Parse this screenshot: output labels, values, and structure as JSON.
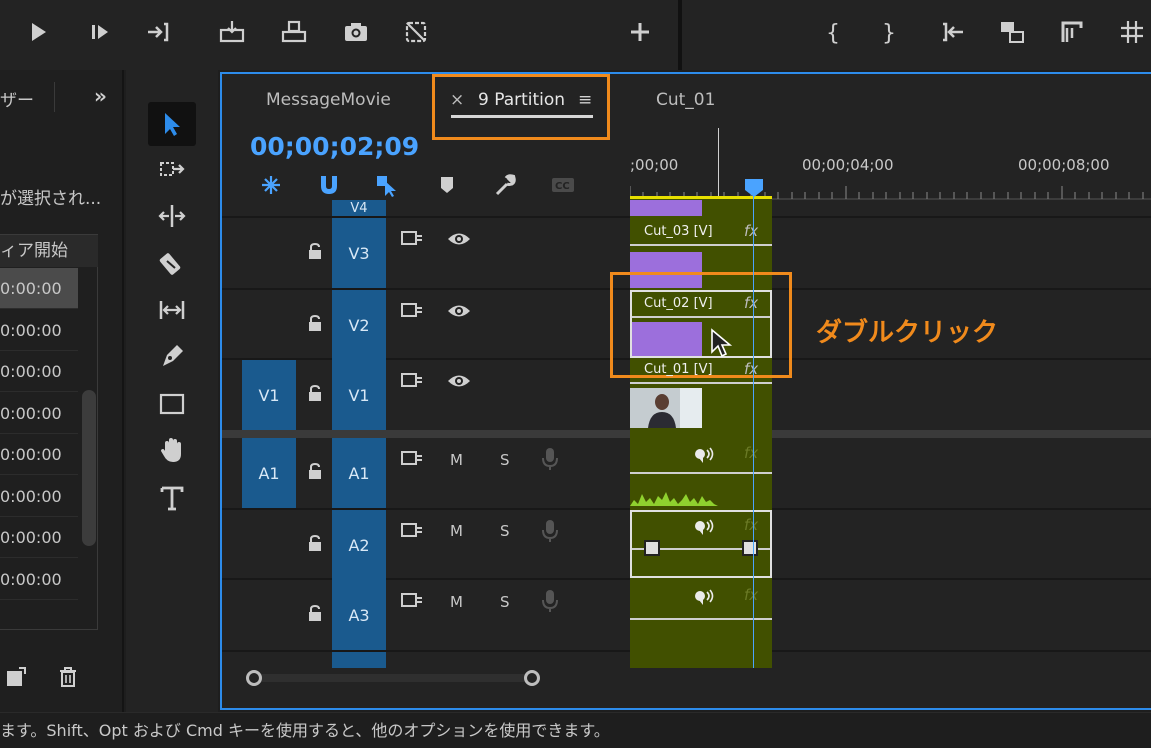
{
  "toolbar": {
    "left_buttons": [
      "play-icon",
      "step-forward-icon",
      "go-to-out-icon",
      "insert-icon",
      "overwrite-icon",
      "export-frame-icon",
      "button-editor-icon",
      "add-button-icon"
    ],
    "right_buttons": [
      "mark-in-icon",
      "mark-out-icon",
      "go-to-in-icon",
      "lift-icon",
      "extract-icon",
      "safe-margins-icon"
    ]
  },
  "project": {
    "header_label": "ザー",
    "more_label": "»",
    "selected_message": "が選択され...",
    "list_header": "ィア開始",
    "timecodes": [
      "0:00:00",
      "0:00:00",
      "0:00:00",
      "0:00:00",
      "0:00:00",
      "0:00:00",
      "0:00:00",
      "0:00:00"
    ]
  },
  "timeline": {
    "tabs": [
      {
        "label": "MessageMovie"
      },
      {
        "label": "9 Partition",
        "close": "×",
        "menu": "≡"
      },
      {
        "label": "Cut_01"
      }
    ],
    "timecode": "00;00;02;09",
    "ruler": [
      ";00;00",
      "00;00;04;00",
      "00;00;08;00"
    ],
    "video_tracks": [
      {
        "name": "V4"
      },
      {
        "name": "V3"
      },
      {
        "name": "V2"
      },
      {
        "name": "V1",
        "source": "V1"
      }
    ],
    "audio_tracks": [
      {
        "name": "A1",
        "source": "A1",
        "m": "M",
        "s": "S"
      },
      {
        "name": "A2",
        "m": "M",
        "s": "S"
      },
      {
        "name": "A3",
        "m": "M",
        "s": "S"
      }
    ],
    "clips": {
      "v3": "Cut_03 [V]",
      "v2": "Cut_02 [V]",
      "v1": "Cut_01 [V]",
      "fx": "fx"
    }
  },
  "annotation": "ダブルクリック",
  "status_bar": "ます。Shift、Opt および Cmd キーを使用すると、他のオプションを使用できます。",
  "colors": {
    "accent_blue": "#2d8ceb",
    "timecode_blue": "#4aa3ff",
    "track_blue": "#1a5a8e",
    "clip_green": "#415000",
    "clip_purple": "#9c6fdc",
    "annotation_orange": "#f08a1c"
  }
}
